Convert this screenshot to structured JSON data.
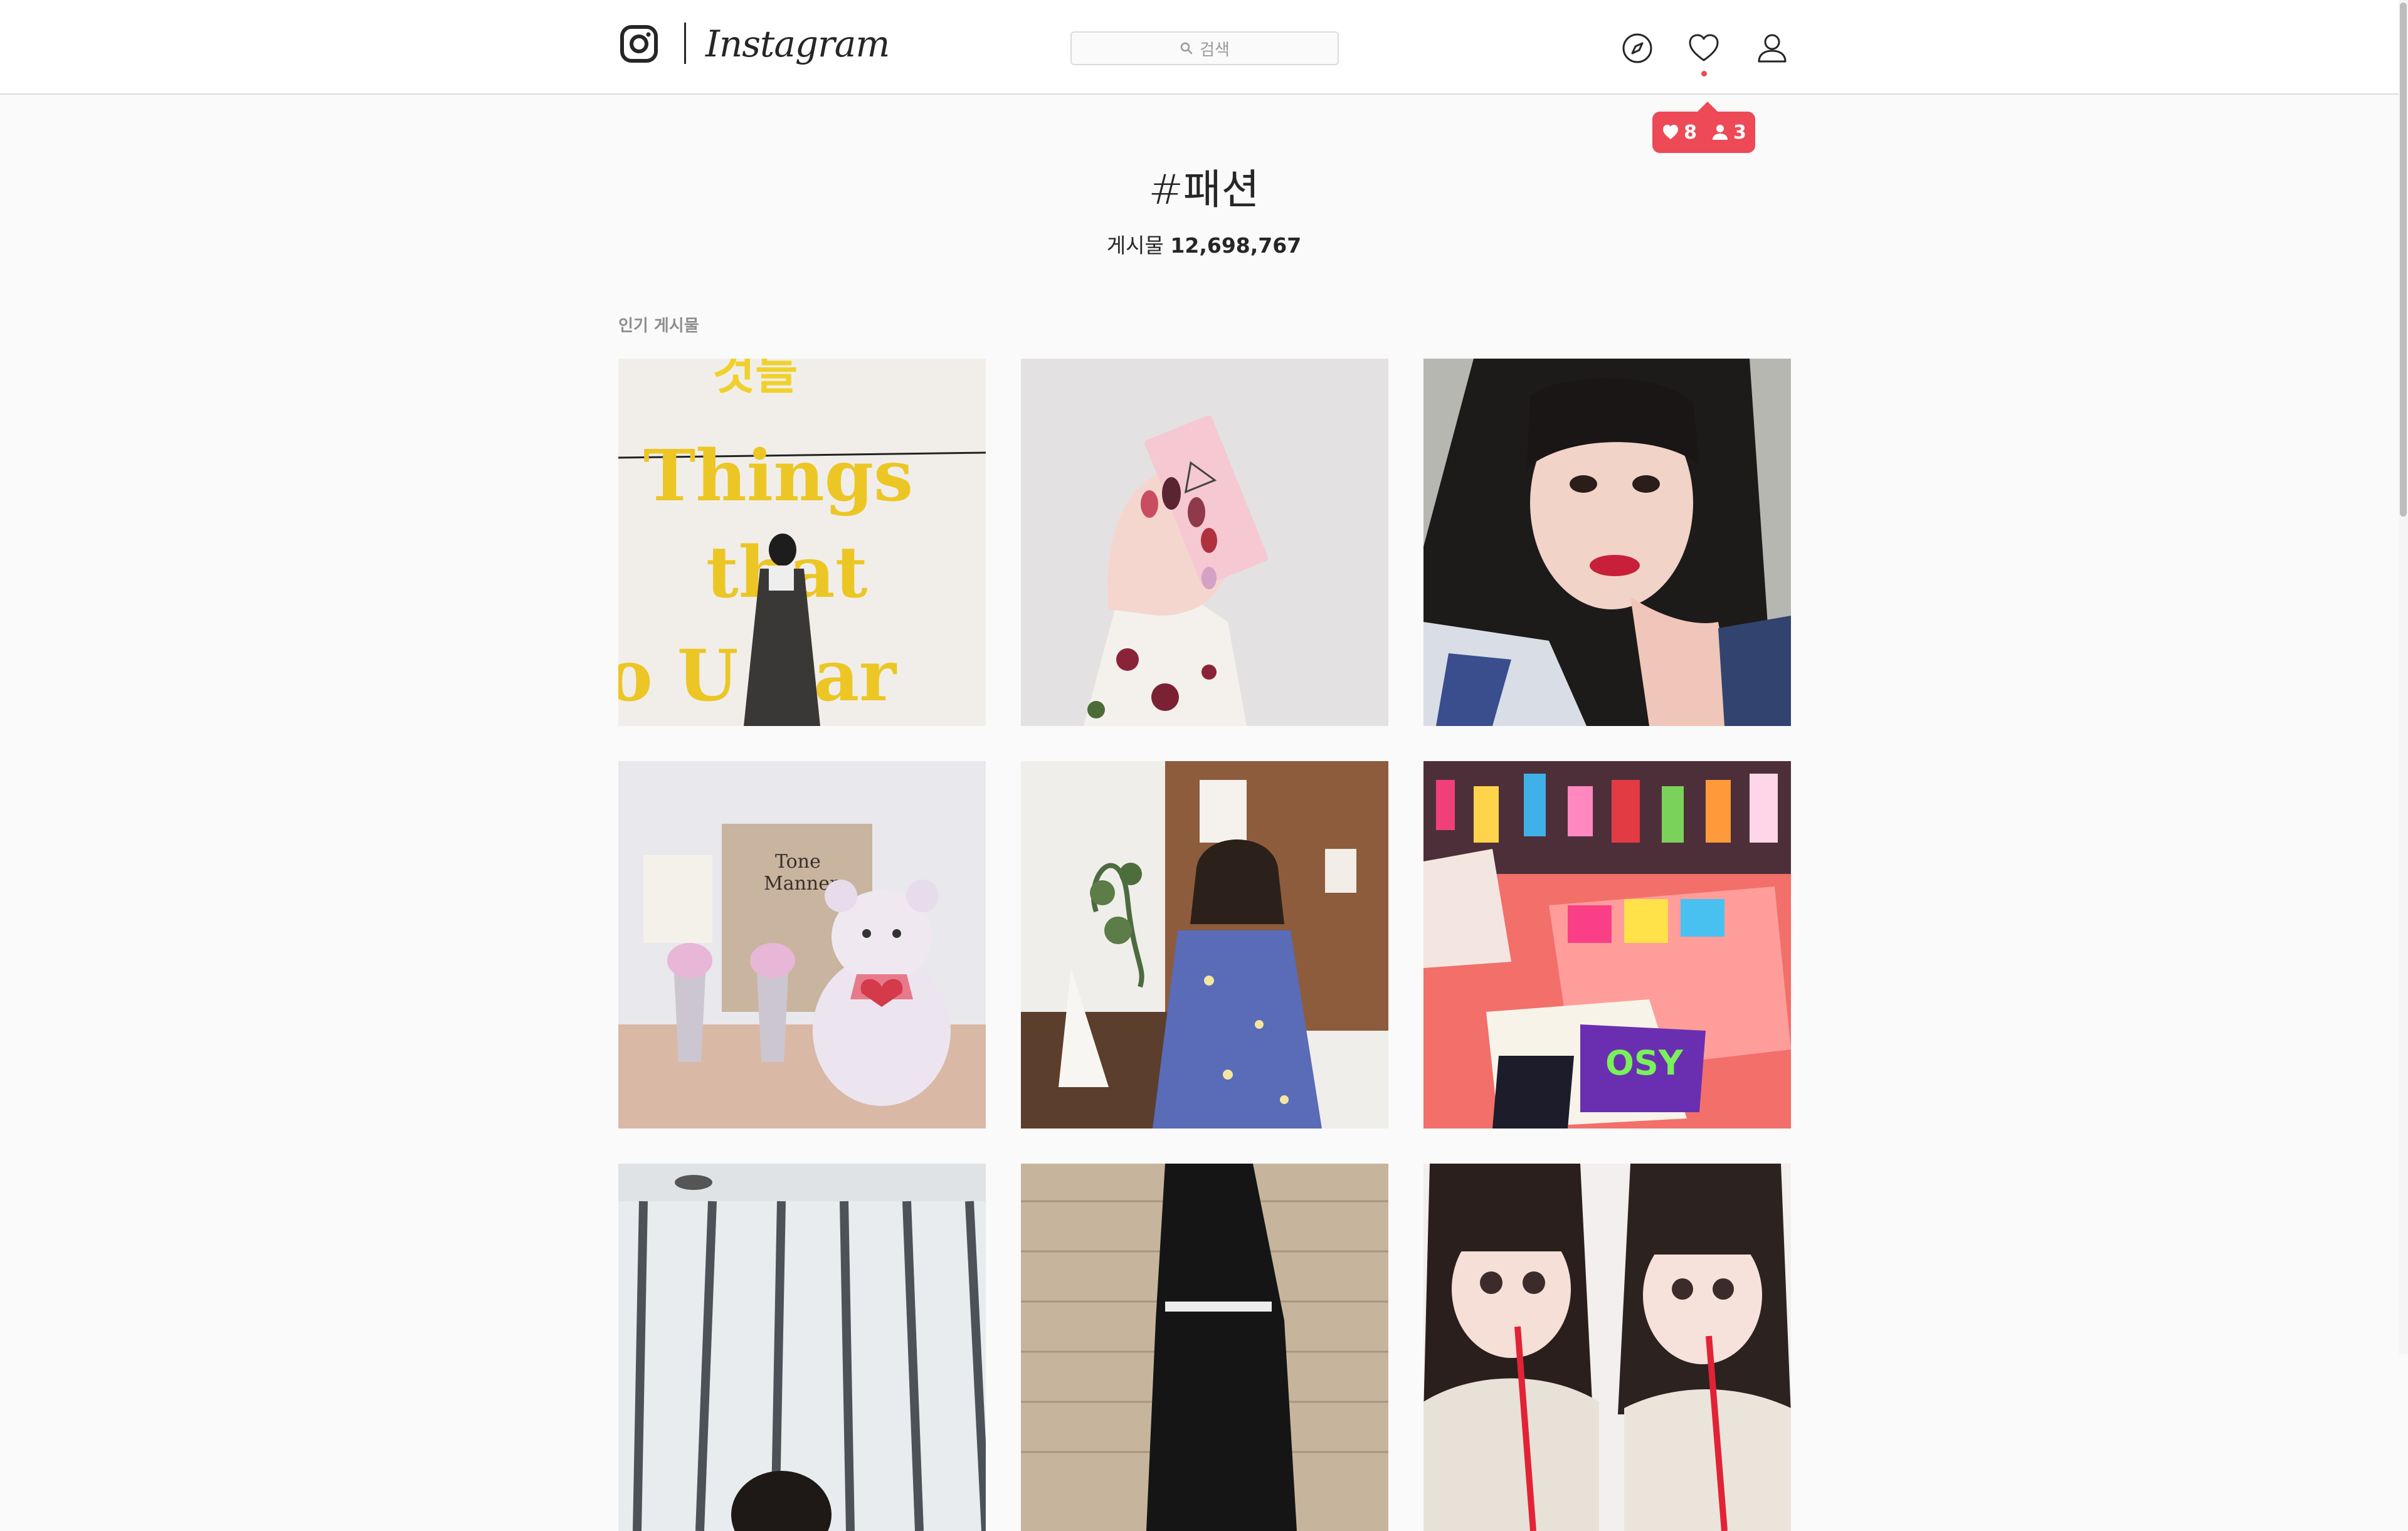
{
  "header": {
    "brand": "Instagram",
    "search_placeholder": "검색",
    "icons": {
      "logo": "instagram-glyph-icon",
      "search": "search-icon",
      "explore": "compass-icon",
      "activity": "heart-icon",
      "profile": "person-icon"
    }
  },
  "notification": {
    "likes_count": "8",
    "follows_count": "3",
    "color": "#ed4956"
  },
  "hashtag": {
    "title": "#패션",
    "count_label": "게시물",
    "count_value": "12,698,767"
  },
  "section": {
    "label": "인기 게시물"
  },
  "posts": [
    {
      "image": "woman-in-coat-before-yellow-things-that-text",
      "overlay_text": [
        "것들",
        "Things",
        "that",
        "o U Par"
      ]
    },
    {
      "image": "hand-with-nails-holding-pink-3ce-box"
    },
    {
      "image": "woman-selfie-dark-hair"
    },
    {
      "image": "teddy-bear-with-drinks-tone-manner"
    },
    {
      "image": "woman-blue-dress-wooden-cafe"
    },
    {
      "image": "colorful-shop-with-t-shirts"
    },
    {
      "image": "woman-near-glass-windows"
    },
    {
      "image": "person-in-black-jacket"
    },
    {
      "image": "two-girls-with-drinks"
    }
  ],
  "colors": {
    "background": "#fafafa",
    "header_bg": "#ffffff",
    "border": "#dbdbdb",
    "text": "#262626",
    "muted": "#8e8e8e",
    "accent": "#ed4956"
  }
}
